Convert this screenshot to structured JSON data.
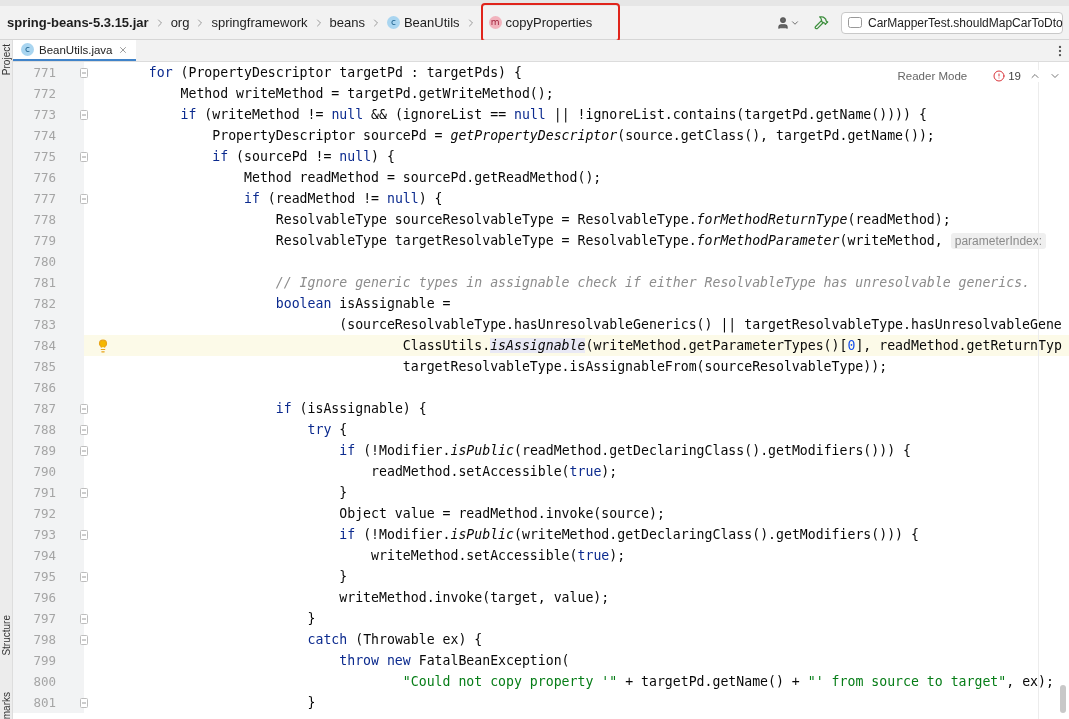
{
  "breadcrumbs": [
    {
      "label": "spring-beans-5.3.15.jar",
      "kind": "jar",
      "annotated": false
    },
    {
      "label": "org",
      "kind": "package",
      "annotated": false
    },
    {
      "label": "springframework",
      "kind": "package",
      "annotated": false
    },
    {
      "label": "beans",
      "kind": "package",
      "annotated": false
    },
    {
      "label": "BeanUtils",
      "kind": "class",
      "badge": "c",
      "annotated": false
    },
    {
      "label": "copyProperties",
      "kind": "method",
      "badge": "m",
      "annotated": true
    }
  ],
  "toolbar": {
    "run_config": "CarMapperTest.shouldMapCarToDto"
  },
  "tool_strip": [
    {
      "label": "Project",
      "kind": "top"
    },
    {
      "label": "Structure",
      "kind": "bottom"
    },
    {
      "label": "marks",
      "kind": "bottom"
    }
  ],
  "tabs": [
    {
      "label": "BeanUtils.java",
      "badge": "c",
      "selected": true
    }
  ],
  "inspection": {
    "reader_mode": "Reader Mode",
    "error_count": "19"
  },
  "editor": {
    "lines": [
      {
        "number": "771",
        "kind": "statement",
        "fold": true,
        "current": false,
        "bulb": false,
        "tokens": [
          {
            "kind": "kw",
            "text": "for"
          },
          {
            "kind": "plain",
            "text": " (PropertyDescriptor targetPd : targetPds) {"
          }
        ],
        "children": [
          {
            "number": "772",
            "kind": "statement",
            "fold": false,
            "current": false,
            "bulb": false,
            "tokens": [
              {
                "kind": "plain",
                "text": "Method writeMethod = targetPd.getWriteMethod();"
              }
            ]
          },
          {
            "number": "773",
            "kind": "statement",
            "fold": true,
            "current": false,
            "bulb": false,
            "tokens": [
              {
                "kind": "kw",
                "text": "if"
              },
              {
                "kind": "plain",
                "text": " (writeMethod != "
              },
              {
                "kind": "kw",
                "text": "null"
              },
              {
                "kind": "plain",
                "text": " && (ignoreList == "
              },
              {
                "kind": "kw",
                "text": "null"
              },
              {
                "kind": "plain",
                "text": " || !ignoreList.contains(targetPd.getName()))) {"
              }
            ],
            "children": [
              {
                "number": "774",
                "kind": "statement",
                "fold": false,
                "current": false,
                "bulb": false,
                "tokens": [
                  {
                    "kind": "plain",
                    "text": "PropertyDescriptor sourcePd = "
                  },
                  {
                    "kind": "italic",
                    "text": "getPropertyDescriptor"
                  },
                  {
                    "kind": "plain",
                    "text": "(source.getClass(), targetPd.getName());"
                  }
                ]
              },
              {
                "number": "775",
                "kind": "statement",
                "fold": true,
                "current": false,
                "bulb": false,
                "tokens": [
                  {
                    "kind": "kw",
                    "text": "if"
                  },
                  {
                    "kind": "plain",
                    "text": " (sourcePd != "
                  },
                  {
                    "kind": "kw",
                    "text": "null"
                  },
                  {
                    "kind": "plain",
                    "text": ") {"
                  }
                ],
                "children": [
                  {
                    "number": "776",
                    "kind": "statement",
                    "fold": false,
                    "current": false,
                    "bulb": false,
                    "tokens": [
                      {
                        "kind": "plain",
                        "text": "Method readMethod = sourcePd.getReadMethod();"
                      }
                    ]
                  },
                  {
                    "number": "777",
                    "kind": "statement",
                    "fold": true,
                    "current": false,
                    "bulb": false,
                    "tokens": [
                      {
                        "kind": "kw",
                        "text": "if"
                      },
                      {
                        "kind": "plain",
                        "text": " (readMethod != "
                      },
                      {
                        "kind": "kw",
                        "text": "null"
                      },
                      {
                        "kind": "plain",
                        "text": ") {"
                      }
                    ],
                    "children": [
                      {
                        "number": "778",
                        "kind": "statement",
                        "fold": false,
                        "current": false,
                        "bulb": false,
                        "tokens": [
                          {
                            "kind": "plain",
                            "text": "ResolvableType sourceResolvableType = ResolvableType."
                          },
                          {
                            "kind": "italic",
                            "text": "forMethodReturnType"
                          },
                          {
                            "kind": "plain",
                            "text": "(readMethod);"
                          }
                        ]
                      },
                      {
                        "number": "779",
                        "kind": "statement",
                        "fold": false,
                        "current": false,
                        "bulb": false,
                        "tokens": [
                          {
                            "kind": "plain",
                            "text": "ResolvableType targetResolvableType = ResolvableType."
                          },
                          {
                            "kind": "italic",
                            "text": "forMethodParameter"
                          },
                          {
                            "kind": "plain",
                            "text": "(writeMethod,"
                          }
                        ],
                        "hint": "parameterIndex:"
                      },
                      {
                        "number": "780",
                        "kind": "statement",
                        "fold": false,
                        "current": false,
                        "bulb": false
                      },
                      {
                        "number": "781",
                        "kind": "statement",
                        "fold": false,
                        "current": false,
                        "bulb": false,
                        "tokens": [
                          {
                            "kind": "comment",
                            "text": "// Ignore generic types in assignable check if either ResolvableType has unresolvable generics."
                          }
                        ]
                      },
                      {
                        "number": "782",
                        "kind": "statement",
                        "fold": false,
                        "current": false,
                        "bulb": false,
                        "tokens": [
                          {
                            "kind": "kw",
                            "text": "boolean"
                          },
                          {
                            "kind": "plain",
                            "text": " isAssignable ="
                          }
                        ],
                        "children": [
                          {
                            "number": "783",
                            "kind": "continuation",
                            "fold": false,
                            "current": false,
                            "bulb": false,
                            "tokens": [
                              {
                                "kind": "plain",
                                "text": "(sourceResolvableType.hasUnresolvableGenerics() || targetResolvableType.hasUnresolvableGene"
                              }
                            ],
                            "children": [
                              {
                                "number": "784",
                                "kind": "continuation",
                                "fold": false,
                                "current": true,
                                "bulb": true,
                                "tokens": [
                                  {
                                    "kind": "plain",
                                    "text": "ClassUtils."
                                  },
                                  {
                                    "kind": "italic_marked",
                                    "text": "isAssignable"
                                  },
                                  {
                                    "kind": "plain",
                                    "text": "(writeMethod.getParameterTypes()["
                                  },
                                  {
                                    "kind": "number",
                                    "text": "0"
                                  },
                                  {
                                    "kind": "plain",
                                    "text": "], readMethod.getReturnTyp"
                                  }
                                ]
                              },
                              {
                                "number": "785",
                                "kind": "continuation",
                                "fold": false,
                                "current": false,
                                "bulb": false,
                                "tokens": [
                                  {
                                    "kind": "plain",
                                    "text": "targetResolvableType.isAssignableFrom(sourceResolvableType));"
                                  }
                                ]
                              }
                            ]
                          }
                        ]
                      },
                      {
                        "number": "786",
                        "kind": "statement",
                        "fold": false,
                        "current": false,
                        "bulb": false
                      },
                      {
                        "number": "787",
                        "kind": "statement",
                        "fold": true,
                        "current": false,
                        "bulb": false,
                        "tokens": [
                          {
                            "kind": "kw",
                            "text": "if"
                          },
                          {
                            "kind": "plain",
                            "text": " (isAssignable) {"
                          }
                        ],
                        "children": [
                          {
                            "number": "788",
                            "kind": "statement",
                            "fold": true,
                            "current": false,
                            "bulb": false,
                            "tokens": [
                              {
                                "kind": "kw",
                                "text": "try"
                              },
                              {
                                "kind": "plain",
                                "text": " {"
                              }
                            ],
                            "children": [
                              {
                                "number": "789",
                                "kind": "statement",
                                "fold": true,
                                "current": false,
                                "bulb": false,
                                "tokens": [
                                  {
                                    "kind": "kw",
                                    "text": "if"
                                  },
                                  {
                                    "kind": "plain",
                                    "text": " (!Modifier."
                                  },
                                  {
                                    "kind": "italic",
                                    "text": "isPublic"
                                  },
                                  {
                                    "kind": "plain",
                                    "text": "(readMethod.getDeclaringClass().getModifiers())) {"
                                  }
                                ],
                                "children": [
                                  {
                                    "number": "790",
                                    "kind": "statement",
                                    "fold": false,
                                    "current": false,
                                    "bulb": false,
                                    "tokens": [
                                      {
                                        "kind": "plain",
                                        "text": "readMethod.setAccessible("
                                      },
                                      {
                                        "kind": "kw",
                                        "text": "true"
                                      },
                                      {
                                        "kind": "plain",
                                        "text": ");"
                                      }
                                    ]
                                  }
                                ]
                              },
                              {
                                "number": "791",
                                "kind": "statement",
                                "fold": true,
                                "current": false,
                                "bulb": false,
                                "tokens": [
                                  {
                                    "kind": "plain",
                                    "text": "}"
                                  }
                                ]
                              },
                              {
                                "number": "792",
                                "kind": "statement",
                                "fold": false,
                                "current": false,
                                "bulb": false,
                                "tokens": [
                                  {
                                    "kind": "plain",
                                    "text": "Object value = readMethod.invoke(source);"
                                  }
                                ]
                              },
                              {
                                "number": "793",
                                "kind": "statement",
                                "fold": true,
                                "current": false,
                                "bulb": false,
                                "tokens": [
                                  {
                                    "kind": "kw",
                                    "text": "if"
                                  },
                                  {
                                    "kind": "plain",
                                    "text": " (!Modifier."
                                  },
                                  {
                                    "kind": "italic",
                                    "text": "isPublic"
                                  },
                                  {
                                    "kind": "plain",
                                    "text": "(writeMethod.getDeclaringClass().getModifiers())) {"
                                  }
                                ],
                                "children": [
                                  {
                                    "number": "794",
                                    "kind": "statement",
                                    "fold": false,
                                    "current": false,
                                    "bulb": false,
                                    "tokens": [
                                      {
                                        "kind": "plain",
                                        "text": "writeMethod.setAccessible("
                                      },
                                      {
                                        "kind": "kw",
                                        "text": "true"
                                      },
                                      {
                                        "kind": "plain",
                                        "text": ");"
                                      }
                                    ]
                                  }
                                ]
                              },
                              {
                                "number": "795",
                                "kind": "statement",
                                "fold": true,
                                "current": false,
                                "bulb": false,
                                "tokens": [
                                  {
                                    "kind": "plain",
                                    "text": "}"
                                  }
                                ]
                              },
                              {
                                "number": "796",
                                "kind": "statement",
                                "fold": false,
                                "current": false,
                                "bulb": false,
                                "tokens": [
                                  {
                                    "kind": "plain",
                                    "text": "writeMethod.invoke(target, value);"
                                  }
                                ]
                              }
                            ]
                          },
                          {
                            "number": "797",
                            "kind": "statement",
                            "fold": true,
                            "current": false,
                            "bulb": false,
                            "tokens": [
                              {
                                "kind": "plain",
                                "text": "}"
                              }
                            ]
                          },
                          {
                            "number": "798",
                            "kind": "statement",
                            "fold": true,
                            "current": false,
                            "bulb": false,
                            "tokens": [
                              {
                                "kind": "kw",
                                "text": "catch"
                              },
                              {
                                "kind": "plain",
                                "text": " (Throwable ex) {"
                              }
                            ],
                            "children": [
                              {
                                "number": "799",
                                "kind": "statement",
                                "fold": false,
                                "current": false,
                                "bulb": false,
                                "tokens": [
                                  {
                                    "kind": "kw",
                                    "text": "throw new"
                                  },
                                  {
                                    "kind": "plain",
                                    "text": " FatalBeanException("
                                  }
                                ],
                                "children": [
                                  {
                                    "number": "800",
                                    "kind": "continuation",
                                    "fold": false,
                                    "current": false,
                                    "bulb": false,
                                    "tokens": [
                                      {
                                        "kind": "string",
                                        "text": "\"Could not copy property '\""
                                      },
                                      {
                                        "kind": "plain",
                                        "text": " + targetPd.getName() + "
                                      },
                                      {
                                        "kind": "string",
                                        "text": "\"' from source to target\""
                                      },
                                      {
                                        "kind": "plain",
                                        "text": ", ex);"
                                      }
                                    ]
                                  }
                                ]
                              }
                            ]
                          },
                          {
                            "number": "801",
                            "kind": "statement",
                            "fold": true,
                            "current": false,
                            "bulb": false,
                            "tokens": [
                              {
                                "kind": "plain",
                                "text": "}"
                              }
                            ]
                          }
                        ]
                      }
                    ]
                  }
                ]
              }
            ]
          }
        ]
      }
    ]
  }
}
